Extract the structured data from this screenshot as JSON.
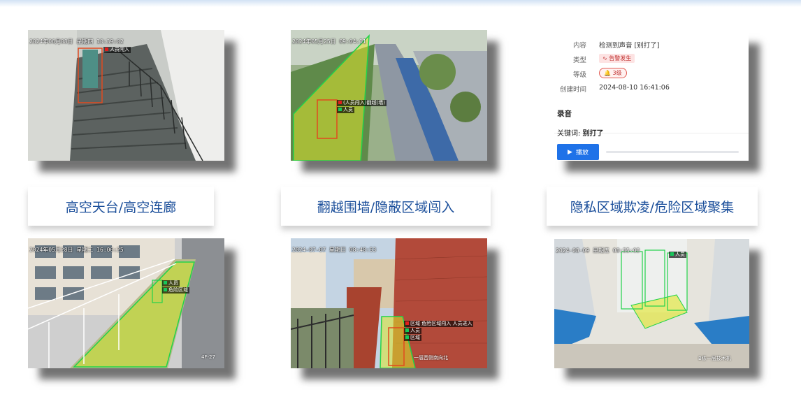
{
  "captions": [
    "高空天台/高空连廊",
    "翻越围墙/隐蔽区域闯入",
    "隐私区域欺凌/危险区域聚集"
  ],
  "shots": {
    "stairs": {
      "timestamp": "2024年06月08日 星期四 10:39:02",
      "tag": "人员闯入"
    },
    "fence": {
      "timestamp": "2024年05月25日 09:04:11",
      "tag1": "(人员闯入)翻越(墙)",
      "tag2": "人员"
    },
    "corridor": {
      "timestamp": "2024年05月28日 星期二 16:06:25",
      "tag1": "人员",
      "tag2": "危险区域",
      "cam": "4F-27"
    },
    "brickwall": {
      "timestamp": "2024-07-07 星期日 08:40:53",
      "tag1": "区域  危险区域闯入 人员进入",
      "tag2": "人员",
      "tag3": "区域 ",
      "cam": "一层西侧南向北"
    },
    "toilet": {
      "timestamp": "2024-08-09 星期五 08:55:03",
      "tag1": "人员",
      "cam": "B栋一层技术机"
    }
  },
  "alert_detail": {
    "content_label": "内容",
    "content_value": "检测到声音 [别打了]",
    "type_label": "类型",
    "type_value": "告警发生",
    "type_icon": "pulse-icon",
    "level_label": "等级",
    "level_value": "3级",
    "level_icon": "bell-icon",
    "created_label": "创建时间",
    "created_value": "2024-08-10 16:41:06",
    "recording_title": "录音",
    "keyword_label": "关键词: ",
    "keyword_value": "别打了",
    "play_label": "播放",
    "play_icon": "play-icon",
    "colors": {
      "primary": "#1f72e8",
      "alert": "#c0302f",
      "caption": "#1a4e9a",
      "detect_green": "#22d34a",
      "detect_red": "#e14a1f"
    }
  }
}
